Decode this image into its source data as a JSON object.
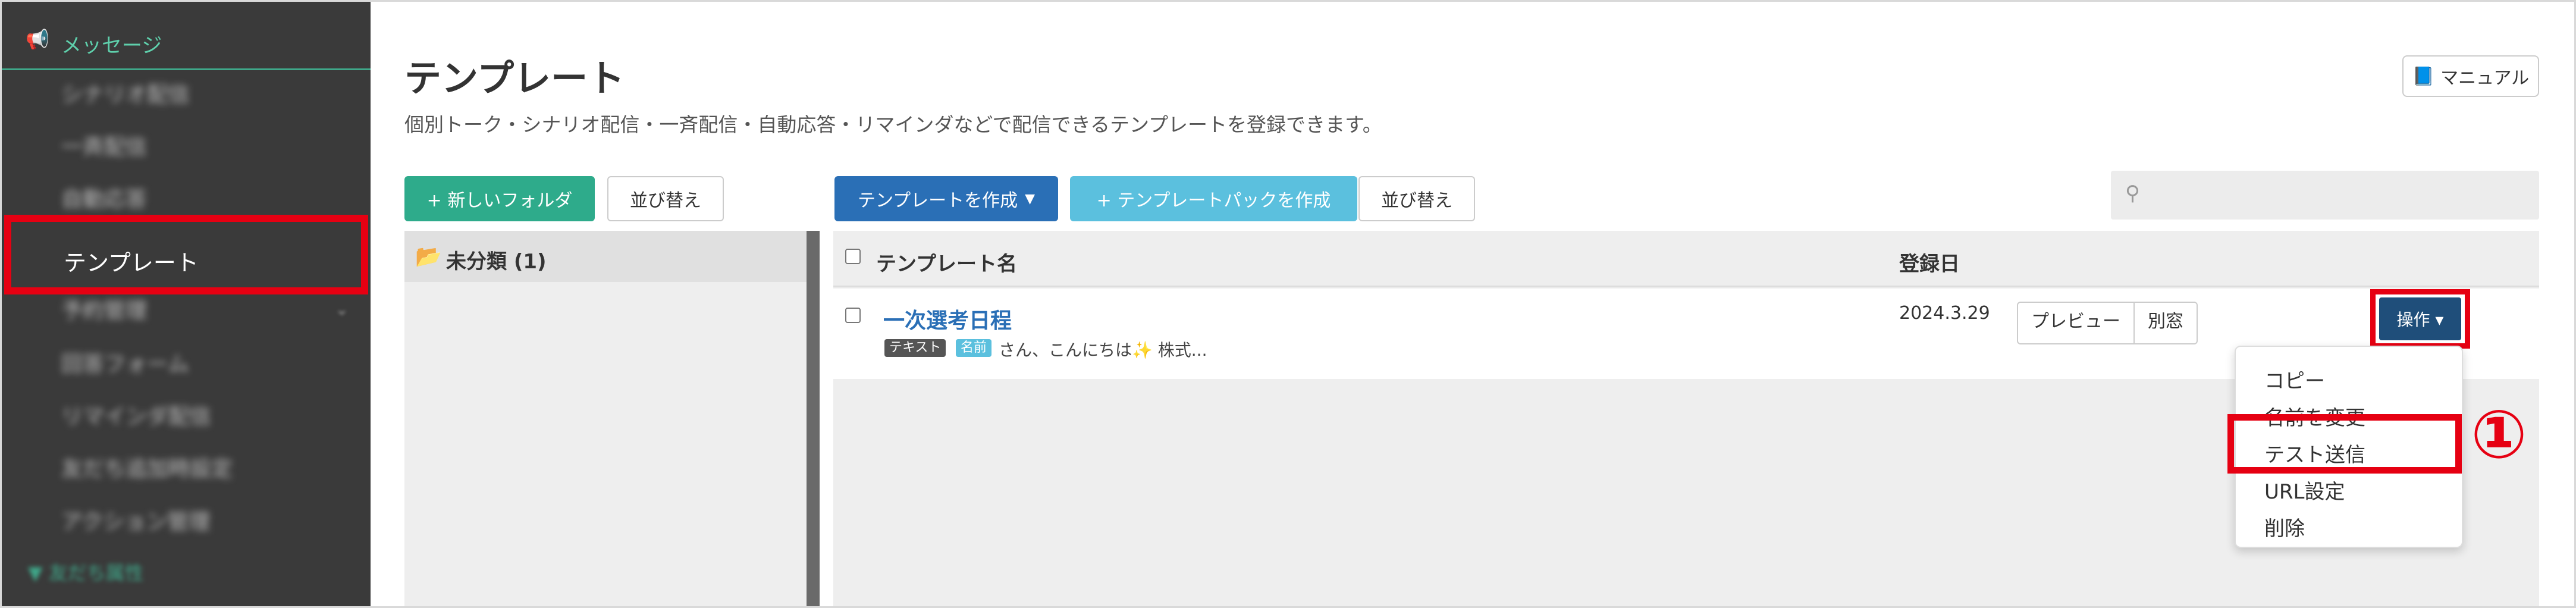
{
  "sidebar": {
    "section_icon": "📢",
    "section_label": "メッセージ",
    "items": [
      {
        "label": "シナリオ配信"
      },
      {
        "label": "一斉配信"
      },
      {
        "label": "自動応答"
      },
      {
        "label": "テンプレート"
      },
      {
        "label": "予約管理"
      },
      {
        "label": "回答フォーム"
      },
      {
        "label": "リマインダ配信"
      },
      {
        "label": "友だち追加時設定"
      },
      {
        "label": "アクション管理"
      }
    ],
    "footer_label": "友だち属性"
  },
  "header": {
    "title": "テンプレート",
    "description": "個別トーク・シナリオ配信・一斉配信・自動応答・リマインダなどで配信できるテンプレートを登録できます。",
    "manual_button": "マニュアル"
  },
  "toolbar": {
    "new_folder": "+ 新しいフォルダ",
    "sort_folders": "並び替え",
    "create_template": "テンプレートを作成",
    "create_pack": "+ テンプレートパックを作成",
    "sort_templates": "並び替え",
    "search_placeholder": ""
  },
  "folders": [
    {
      "label": "未分類 (1)"
    }
  ],
  "table": {
    "headers": {
      "name": "テンプレート名",
      "date": "登録日"
    },
    "rows": [
      {
        "name": "一次選考日程",
        "tag_text": "テキスト",
        "tag_name": "名前",
        "excerpt": "さん、こんにちは✨ 株式...",
        "date": "2024.3.29",
        "preview_label": "プレビュー",
        "window_label": "別窓",
        "ops_label": "操作 ▾"
      }
    ]
  },
  "menu": {
    "items": [
      "コピー",
      "名前を変更",
      "テスト送信",
      "URL設定",
      "削除"
    ]
  },
  "annotation": {
    "step": "①"
  },
  "colors": {
    "sidebar_bg": "#3a3a3a",
    "accent_green": "#2eab8b",
    "primary_blue": "#2a6fb6",
    "cyan": "#5bc0de",
    "highlight_red": "#e60012"
  }
}
